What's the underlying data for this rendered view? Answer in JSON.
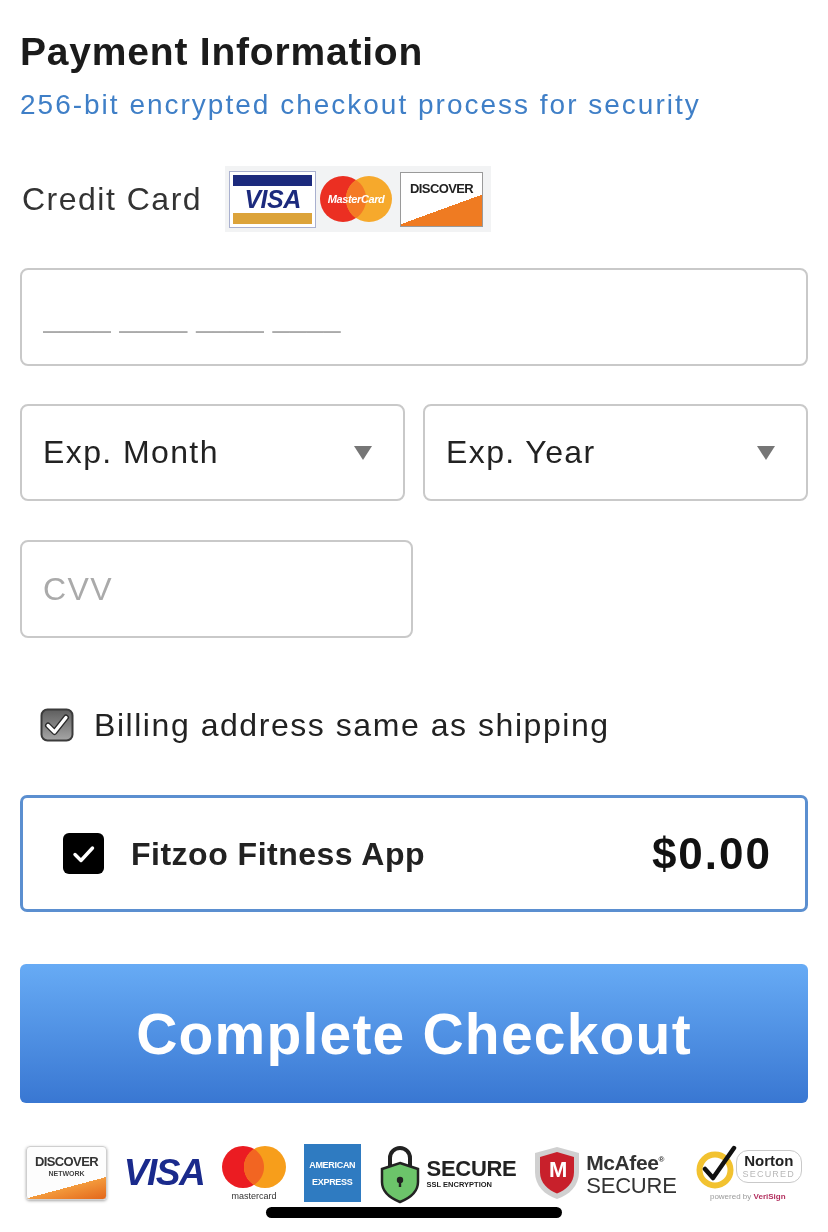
{
  "header": {
    "title": "Payment Information",
    "subtitle": "256-bit encrypted checkout process for security"
  },
  "payment_method": {
    "label": "Credit Card",
    "card_logos": [
      {
        "kind": "visa",
        "text": "VISA"
      },
      {
        "kind": "mastercard",
        "text": "MasterCard"
      },
      {
        "kind": "discover",
        "text": "DISCOVER"
      }
    ]
  },
  "card_number": {
    "placeholder": "____ ____ ____ ____"
  },
  "expiry": [
    {
      "value": "Exp. Month"
    },
    {
      "value": "Exp. Year"
    }
  ],
  "cvv": {
    "placeholder": "CVV"
  },
  "billing_same_as_shipping": {
    "label": "Billing address same as shipping",
    "checked": true
  },
  "order_item": {
    "name": "Fitzoo Fitness App",
    "price": "$0.00",
    "checked": true
  },
  "checkout_button": {
    "label": "Complete Checkout"
  },
  "trust_badges": [
    {
      "kind": "discover",
      "lines": [
        "DISCOVER",
        "NETWORK"
      ]
    },
    {
      "kind": "visa",
      "lines": [
        "VISA"
      ]
    },
    {
      "kind": "mastercard",
      "lines": [
        "mastercard"
      ]
    },
    {
      "kind": "amex",
      "lines": [
        "AMERICAN",
        "EXPRESS"
      ]
    },
    {
      "kind": "ssl",
      "lines": [
        "SECURE",
        "SSL ENCRYPTION"
      ]
    },
    {
      "kind": "mcafee",
      "mark": "M",
      "lines": [
        "McAfee$^{®}$",
        "SECURE"
      ]
    },
    {
      "kind": "norton",
      "lines": [
        "Norton",
        "SECURED",
        "powered by **VeriSign**"
      ]
    }
  ]
}
